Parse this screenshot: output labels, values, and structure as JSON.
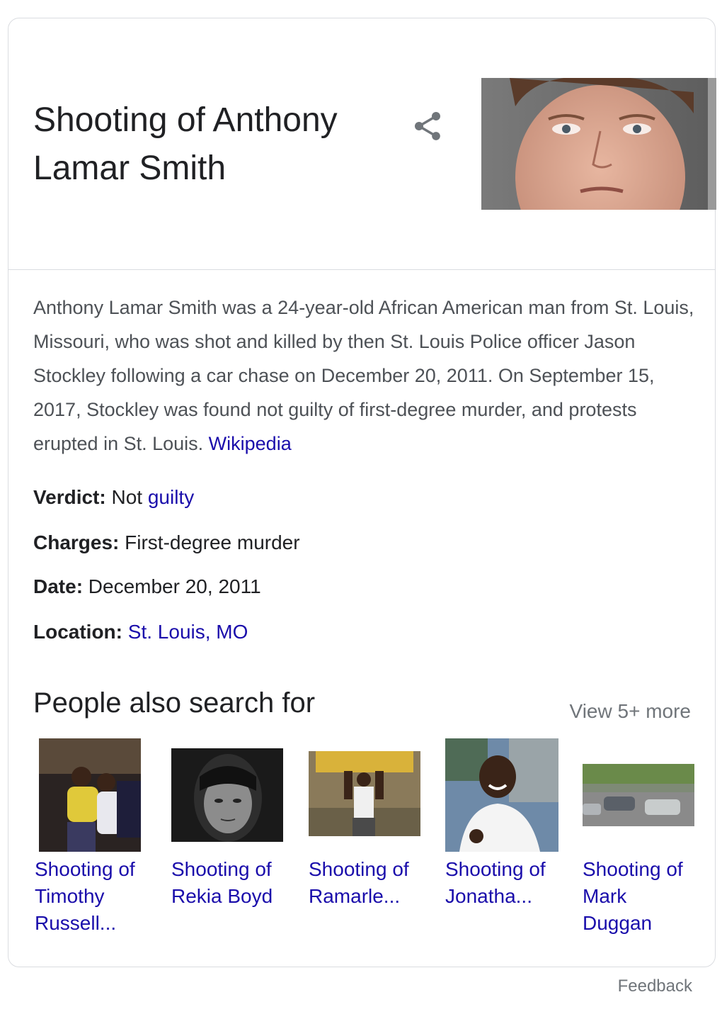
{
  "header": {
    "title": "Shooting of Anthony Lamar Smith",
    "share_icon": "share-icon"
  },
  "description": {
    "text": "Anthony Lamar Smith was a 24-year-old African American man from St. Louis, Missouri, who was shot and killed by then St. Louis Police officer Jason Stockley following a car chase on December 20, 2011. On September 15, 2017, Stockley was found not guilty of first-degree murder, and protests erupted in St. Louis.",
    "source_link": "Wikipedia"
  },
  "facts": {
    "verdict_key": "Verdict:",
    "verdict_text": "Not",
    "verdict_link": "guilty",
    "charges_key": "Charges:",
    "charges_value": "First-degree murder",
    "date_key": "Date:",
    "date_value": "December 20, 2011",
    "location_key": "Location:",
    "location_link": "St. Louis, MO"
  },
  "people_also_search": {
    "title": "People also search for",
    "view_more": "View 5+ more",
    "items": [
      {
        "line1": "Shooting of",
        "line2": "Timothy",
        "line3": "Russell..."
      },
      {
        "line1": "Shooting of",
        "line2": "Rekia Boyd",
        "line3": ""
      },
      {
        "line1": "Shooting of",
        "line2": "Ramarle...",
        "line3": ""
      },
      {
        "line1": "Shooting of",
        "line2": "Jonatha...",
        "line3": ""
      },
      {
        "line1": "Shooting of",
        "line2": "Mark",
        "line3": "Duggan"
      }
    ]
  },
  "footer": {
    "feedback": "Feedback"
  },
  "colors": {
    "link": "#1a0dab",
    "text": "#202124",
    "secondary": "#70757a",
    "description": "#4d5156",
    "border": "#dadce0"
  }
}
